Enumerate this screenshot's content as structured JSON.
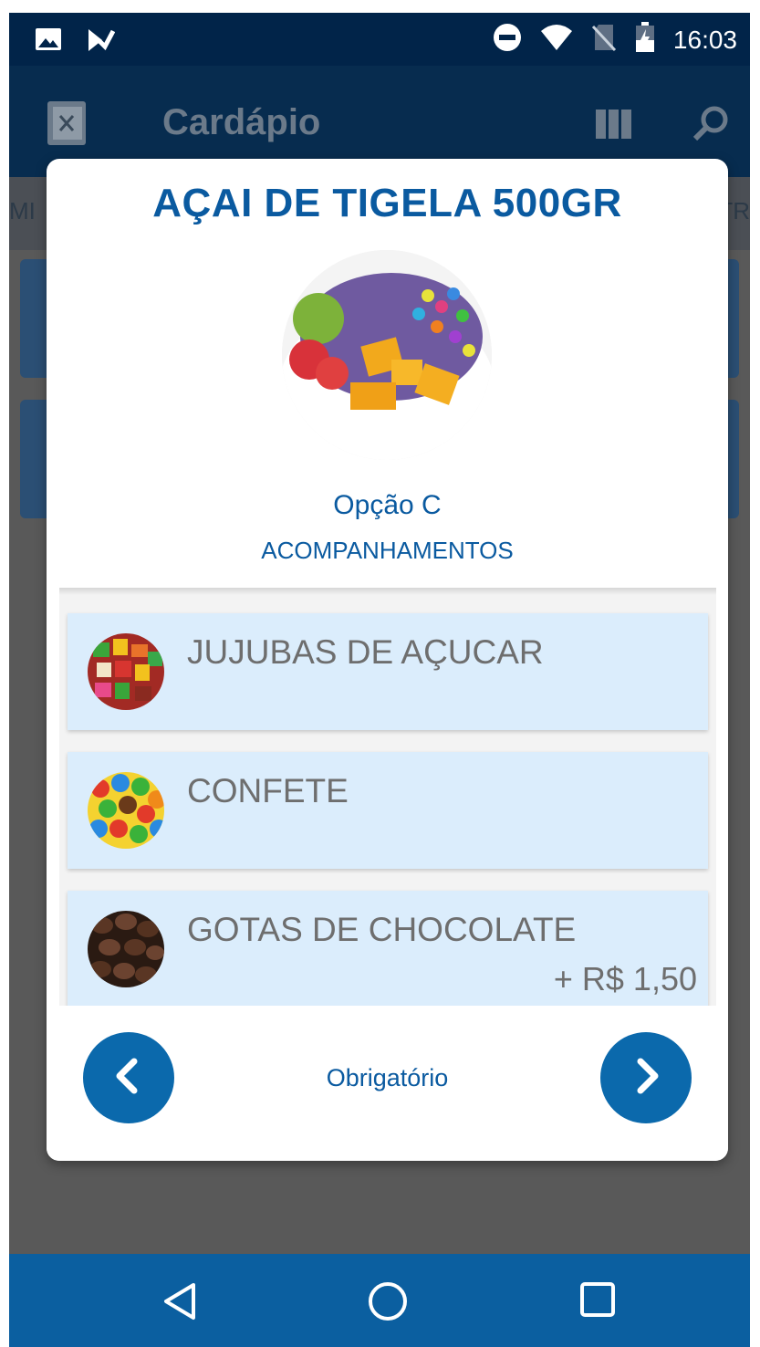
{
  "status_bar": {
    "time": "16:03",
    "left_icons": [
      "image-icon",
      "checkmark-notification-icon"
    ],
    "right_icons": [
      "do-not-disturb-icon",
      "wifi-icon",
      "no-sim-icon",
      "battery-charging-icon"
    ]
  },
  "app_bar": {
    "title": "Cardápio",
    "icons": [
      "menu-book-icon",
      "grid-view-icon",
      "search-icon"
    ]
  },
  "background_tabs": {
    "left_fragment": "MI",
    "right_fragment": "UTR"
  },
  "dialog": {
    "title": "AÇAI DE TIGELA 500GR",
    "option_name": "Opção C",
    "option_section": "ACOMPANHAMENTOS",
    "items": [
      {
        "name": "JUJUBAS DE AÇUCAR",
        "price": "",
        "thumb": "candy-icon"
      },
      {
        "name": "CONFETE",
        "price": "",
        "thumb": "candy-icon"
      },
      {
        "name": "GOTAS DE CHOCOLATE",
        "price": "+ R$ 1,50",
        "thumb": "chocolate-icon"
      }
    ],
    "footer_label": "Obrigatório",
    "prev_icon": "chevron-left-icon",
    "next_icon": "chevron-right-icon"
  },
  "system_nav": {
    "icons": [
      "back-icon",
      "home-icon",
      "recents-icon"
    ]
  },
  "colors": {
    "primary": "#0a5aa0",
    "button": "#0b69ac",
    "item_bg": "#dbedfc",
    "status_bar": "#012449",
    "nav_bar": "#0b5fa0",
    "overlay": "#595959"
  }
}
